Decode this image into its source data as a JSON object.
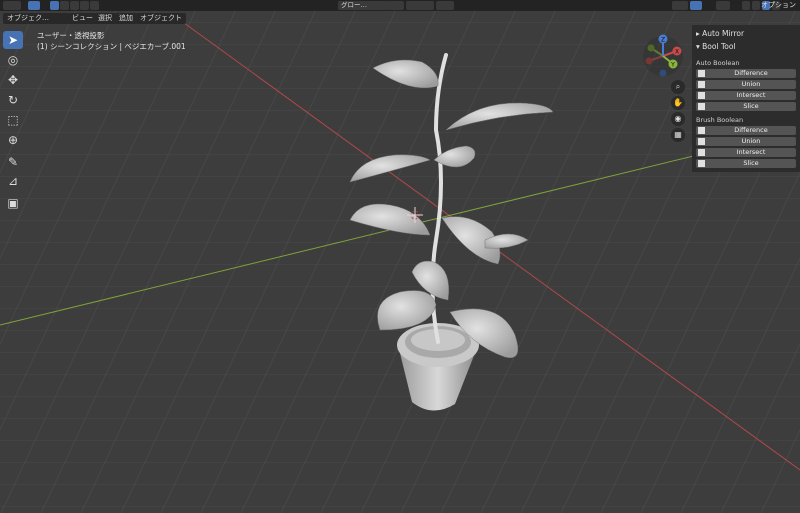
{
  "topbar": {
    "options_label": "オプション"
  },
  "header": {
    "mode_label": "オブジェク…",
    "menus": [
      "ビュー",
      "選択",
      "追加",
      "オブジェクト"
    ],
    "transform_orientation": "グロー…"
  },
  "viewport": {
    "view_name": "ユーザー・透視投影",
    "collection_info": "(1) シーンコレクション | ベジエカーブ.001"
  },
  "toolbar": {
    "tools": [
      "select-box",
      "cursor",
      "move",
      "rotate",
      "scale",
      "transform",
      "annotate",
      "measure",
      "add-cube"
    ]
  },
  "gizmo": {
    "axes": [
      "X",
      "Y",
      "Z"
    ]
  },
  "npanel": {
    "auto_mirror": "Auto Mirror",
    "bool_tool": "Bool Tool",
    "auto_boolean_label": "Auto Boolean",
    "brush_boolean_label": "Brush Boolean",
    "auto_buttons": [
      "Difference",
      "Union",
      "Intersect",
      "Slice"
    ],
    "brush_buttons": [
      "Difference",
      "Union",
      "Intersect",
      "Slice"
    ]
  },
  "colors": {
    "accent": "#4772b3",
    "x_axis": "#c84b4b",
    "y_axis": "#8ab43c",
    "z_axis": "#4a7cd3",
    "grid_bg": "#3d3d3d"
  }
}
